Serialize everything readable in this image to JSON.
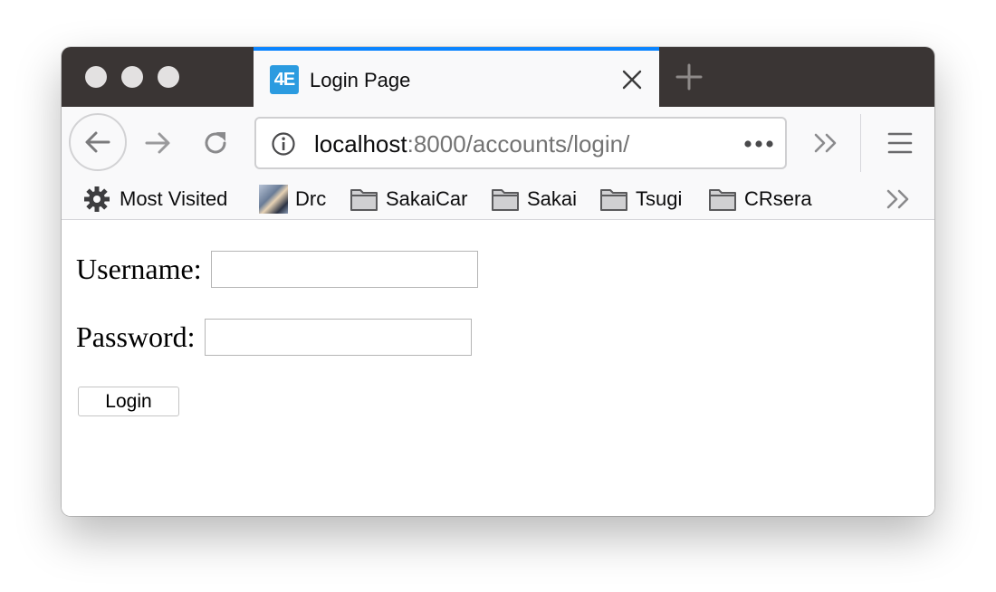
{
  "tab": {
    "favicon_text": "4E",
    "title": "Login Page"
  },
  "urlbar": {
    "host": "localhost",
    "path": ":8000/accounts/login/"
  },
  "bookmarks": [
    {
      "label": "Most Visited",
      "icon": "gear-icon"
    },
    {
      "label": "Drc",
      "icon": "avatar-image"
    },
    {
      "label": "SakaiCar",
      "icon": "folder-icon"
    },
    {
      "label": "Sakai",
      "icon": "folder-icon"
    },
    {
      "label": "Tsugi",
      "icon": "folder-icon"
    },
    {
      "label": "CRsera",
      "icon": "folder-icon"
    }
  ],
  "form": {
    "username_label": "Username:",
    "username_value": "",
    "password_label": "Password:",
    "password_value": "",
    "login_label": "Login"
  },
  "colors": {
    "titlebar": "#3a3534",
    "tab_accent": "#0a84ff",
    "favicon_bg": "#2b9be0",
    "toolbar": "#f9f9fa"
  }
}
